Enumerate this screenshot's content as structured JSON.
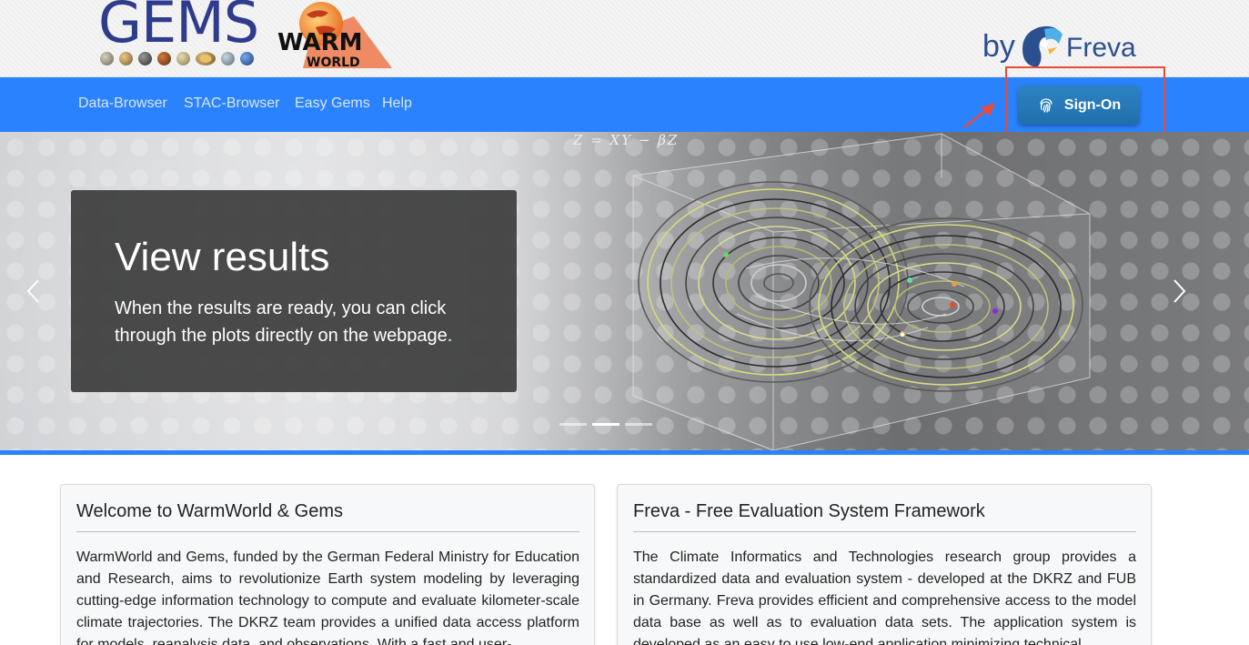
{
  "header": {
    "gems_logo_text": "GEMS",
    "warm_logo_line1": "WARM",
    "warm_logo_line2": "WORLD",
    "freva_by": "by",
    "freva_name": "Freva"
  },
  "nav": {
    "items": [
      {
        "label": "Data-Browser"
      },
      {
        "label": "STAC-Browser"
      },
      {
        "label": "Easy Gems"
      },
      {
        "label": "Help"
      }
    ],
    "signon_label": "Sign-On"
  },
  "carousel": {
    "equation": "Z  =  XY − βZ",
    "title": "View results",
    "text": "When the results are ready, you can click through the plots directly on the webpage.",
    "slide_count": 3,
    "active_slide": 2
  },
  "cards": [
    {
      "title": "Welcome to WarmWorld & Gems",
      "body": "WarmWorld and Gems, funded by the German Federal Ministry for Education and Research, aims to revolutionize Earth system modeling by leveraging cutting-edge information technology to compute and evaluate kilometer-scale climate trajectories. The DKRZ team provides a unified data access platform for models, reanalysis data, and observations. With a fast and user-"
    },
    {
      "title": "Freva - Free Evaluation System Framework",
      "body": "The Climate Informatics and Technologies research group provides a standardized data and evaluation system - developed at the DKRZ and FUB in Germany. Freva provides efficient and comprehensive access to the model data base as well as to evaluation data sets. The application system is developed as an easy to use low-end application minimizing technical"
    }
  ],
  "colors": {
    "navbar": "#2b82fe",
    "signon_button": "#216fac",
    "highlight": "#e74c3c",
    "gems_blue": "#2f3b8c"
  },
  "icons": {
    "signon": "fingerprint-icon",
    "prev": "chevron-left-icon",
    "next": "chevron-right-icon"
  }
}
